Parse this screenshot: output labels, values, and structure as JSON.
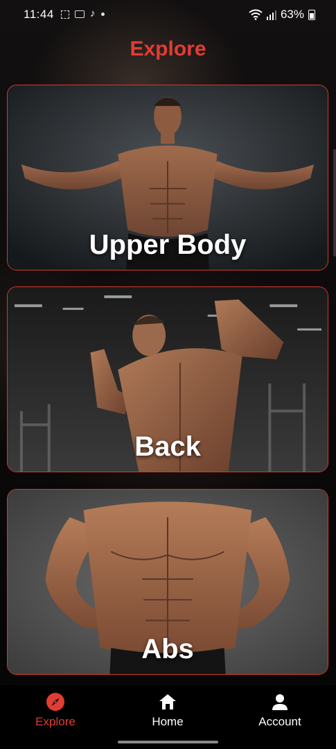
{
  "status_bar": {
    "time": "11:44",
    "battery_percent": "63%",
    "icons": [
      "screenshot-icon",
      "screen-record-icon",
      "tiktok-icon",
      "notification-dot-icon",
      "wifi-icon",
      "signal-icon",
      "battery-icon"
    ]
  },
  "header": {
    "title": "Explore"
  },
  "cards": [
    {
      "label": "Upper Body"
    },
    {
      "label": "Back"
    },
    {
      "label": "Abs"
    }
  ],
  "bottom_nav": {
    "items": [
      {
        "label": "Explore",
        "icon": "compass-icon",
        "active": true
      },
      {
        "label": "Home",
        "icon": "home-icon",
        "active": false
      },
      {
        "label": "Account",
        "icon": "person-icon",
        "active": false
      }
    ]
  },
  "colors": {
    "accent": "#e23c33",
    "card_border": "#d23a30",
    "background": "#050505"
  }
}
